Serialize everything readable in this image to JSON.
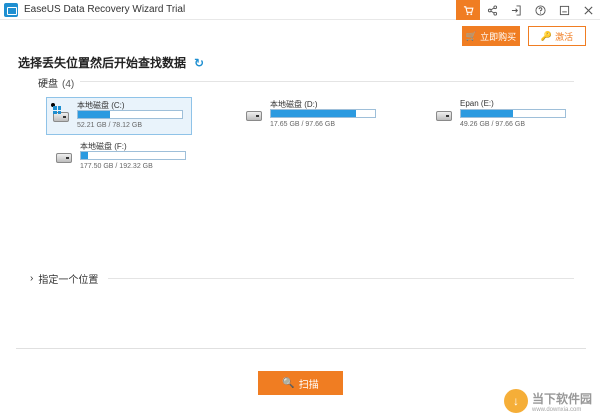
{
  "window": {
    "title": "EaseUS Data Recovery Wizard Trial"
  },
  "titlebar": {
    "buttons": [
      {
        "name": "cart-icon"
      },
      {
        "name": "share-icon"
      },
      {
        "name": "login-icon"
      },
      {
        "name": "help-icon"
      },
      {
        "name": "minimize-icon"
      },
      {
        "name": "close-icon"
      }
    ]
  },
  "actions": {
    "buy_label": "立即购买",
    "activate_label": "激活"
  },
  "main": {
    "heading": "选择丢失位置然后开始查找数据",
    "drives_label": "硬盘",
    "drives_count": "(4)",
    "drives": [
      {
        "name": "本地磁盘 (C:)",
        "size": "52.21 GB / 78.12 GB",
        "used_fraction": 0.31,
        "selected": true,
        "system": true
      },
      {
        "name": "本地磁盘 (D:)",
        "size": "17.65 GB / 97.66 GB",
        "used_fraction": 0.82,
        "selected": false,
        "system": false
      },
      {
        "name": "Epan (E:)",
        "size": "49.26 GB / 97.66 GB",
        "used_fraction": 0.5,
        "selected": false,
        "system": false
      },
      {
        "name": "本地磁盘 (F:)",
        "size": "177.50 GB / 192.32 GB",
        "used_fraction": 0.07,
        "selected": false,
        "system": false
      }
    ],
    "specify_location_label": "指定一个位置"
  },
  "footer": {
    "scan_label": "扫描"
  },
  "watermark": {
    "brand": "当下软件园",
    "url": "www.downxia.com"
  },
  "colors": {
    "accent": "#f07d22",
    "progress": "#2b9ae0",
    "selected_bg": "#e9f3fb"
  }
}
